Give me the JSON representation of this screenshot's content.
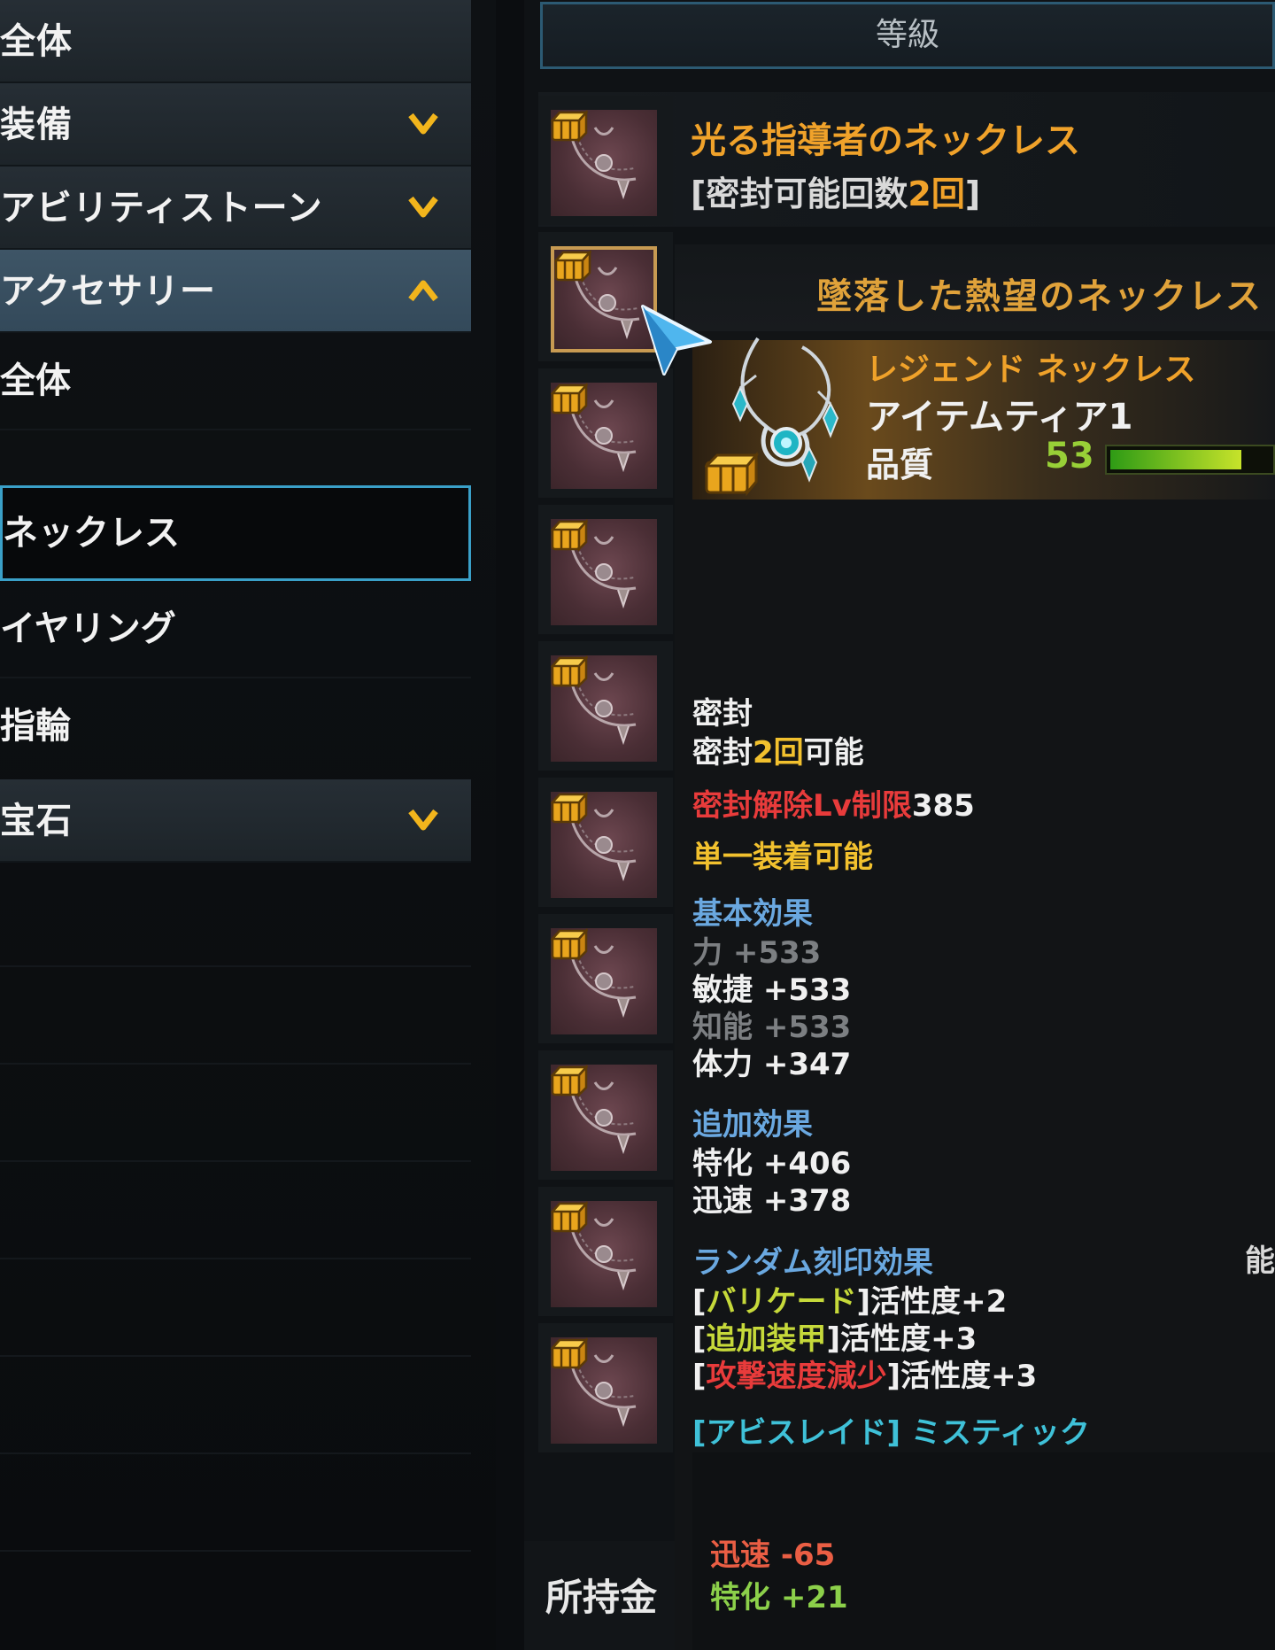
{
  "sidebar": {
    "items": [
      {
        "label": "全体",
        "expandable": false,
        "state": "none"
      },
      {
        "label": "装備",
        "expandable": true,
        "state": "collapsed"
      },
      {
        "label": "アビリティストーン",
        "expandable": true,
        "state": "collapsed"
      },
      {
        "label": "アクセサリー",
        "expandable": true,
        "state": "expanded"
      },
      {
        "label": "宝石",
        "expandable": true,
        "state": "collapsed"
      }
    ],
    "subitems": [
      {
        "label": "全体"
      },
      {
        "label": "ネックレス",
        "selected": true
      },
      {
        "label": "イヤリング"
      },
      {
        "label": "指輪"
      }
    ]
  },
  "list": {
    "header": "等級",
    "first_item": {
      "name": "光る指導者のネックレス",
      "seal_prefix": "[密封可能回数",
      "seal_count": "2回",
      "seal_suffix": "]"
    },
    "icon_count": 10,
    "selected_index": 1
  },
  "tooltip": {
    "title": "墜落した熱望のネックレス",
    "grade": "レジェンド ネックレス",
    "tier": "アイテムティア1",
    "quality_label": "品質",
    "quality_value": "53",
    "quality_fraction": 0.53,
    "seal_header": "密封",
    "seal_prefix": "密封",
    "seal_count": "2回",
    "seal_suffix": "可能",
    "unseal_label": "密封解除Lv制限",
    "unseal_value": "385",
    "single_equip": "単一装着可能",
    "basic_header": "基本効果",
    "basic": [
      {
        "text": "力 +533",
        "color": "gray"
      },
      {
        "text": "敏捷 +533",
        "color": "white"
      },
      {
        "text": "知能 +533",
        "color": "gray"
      },
      {
        "text": "体力 +347",
        "color": "white"
      }
    ],
    "additional_header": "追加効果",
    "additional": [
      "特化 +406",
      "迅速 +378"
    ],
    "engraving_header": "ランダム刻印効果",
    "engravings": [
      {
        "name": "バリケード",
        "value": "活性度+2",
        "color": "lime"
      },
      {
        "name": "追加装甲",
        "value": "活性度+3",
        "color": "lime"
      },
      {
        "name": "攻撃速度減少",
        "value": "活性度+3",
        "color": "red"
      }
    ],
    "set_effect": "[アビスレイド] ミスティック",
    "cutoff_text": "能",
    "compare": [
      {
        "text": "迅速 -65",
        "color": "salmon"
      },
      {
        "text": "特化 +21",
        "color": "green"
      }
    ]
  },
  "footer": {
    "money_label": "所持金"
  },
  "colors": {
    "accent_gold": "#f0a22a",
    "selection_border": "#3aa0c8",
    "quality_green": "#98d037"
  }
}
